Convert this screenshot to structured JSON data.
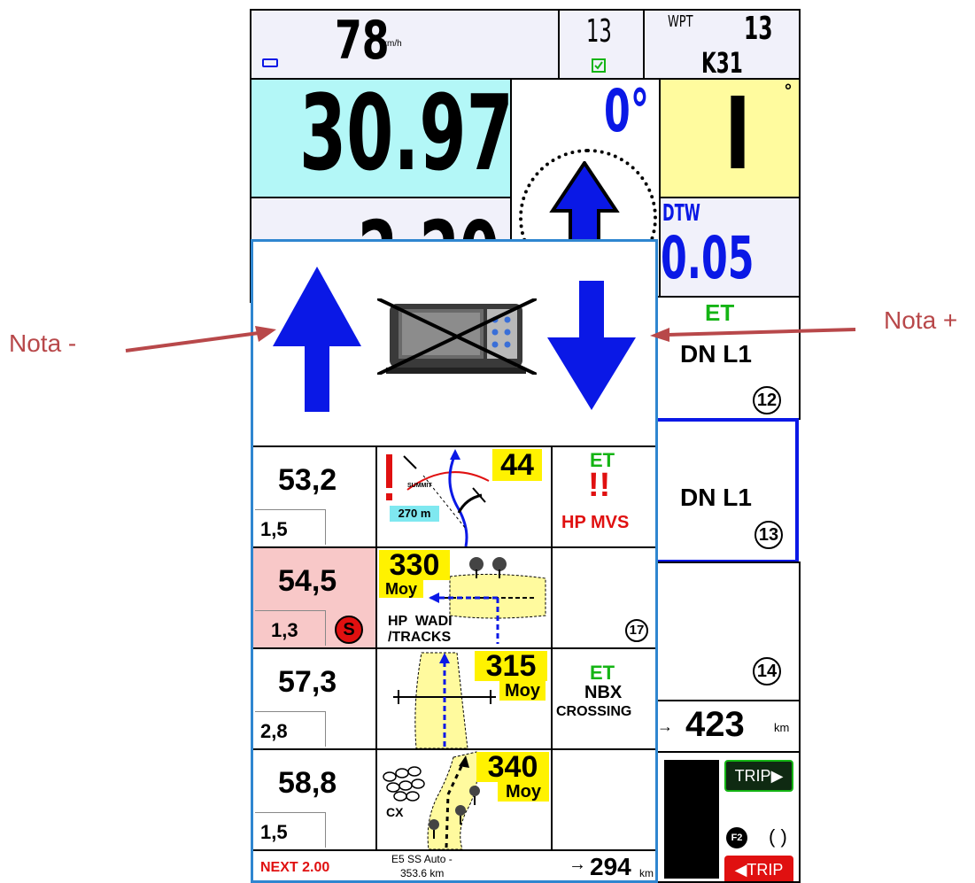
{
  "annotations": {
    "left_label": "Nota -",
    "right_label": "Nota +"
  },
  "colors": {
    "cyan": "#b3f7f7",
    "lightyellow": "#fffb9e",
    "pink": "#f8c8c8",
    "blue": "#0a18e6",
    "green": "#14b414",
    "red": "#e01010",
    "annot": "#b8484a",
    "frame": "#2f86d0"
  },
  "top_bar": {
    "speed": "78",
    "speed_unit": "km/h",
    "wpt_count": "13",
    "wpt_label": "WPT",
    "wpt_number": "13",
    "wpt_name": "K31"
  },
  "nav": {
    "distance_main": "30.97",
    "distance_partial": "2.20",
    "heading": "0°",
    "cap": "I",
    "cap_degree": "°",
    "dtw_label": "DTW",
    "dtw_value": "0.05"
  },
  "right_column": {
    "et1_label": "ET",
    "et1_value": "DN L1",
    "et1_number": "12",
    "et2_value": "DN L1",
    "et2_number": "13",
    "et3_number": "14",
    "total_distance": "423",
    "total_unit": "km",
    "trip_forward": "TRIP",
    "trip_back": "TRIP",
    "f2_label": "F2",
    "paren": "( )"
  },
  "popup": {
    "action_left": "note-minus",
    "action_center": "toggle-device",
    "action_right": "note-plus"
  },
  "roadbook": {
    "rows": [
      {
        "km": "53,2",
        "partial": "1,5",
        "cap": "44",
        "dist_label": "270 m",
        "summit": "SUMMIT",
        "et": "ET",
        "alert": "!!",
        "note": "HP MVS"
      },
      {
        "km": "54,5",
        "partial": "1,3",
        "speed_badge": "S",
        "cap": "330",
        "moy": "Moy",
        "hp": "HP  WADI",
        "tracks": "/TRACKS",
        "number": "17"
      },
      {
        "km": "57,3",
        "partial": "2,8",
        "cap": "315",
        "moy": "Moy",
        "et": "ET",
        "nbx": "NBX",
        "crossing": "CROSSING"
      },
      {
        "km": "58,8",
        "partial": "1,5",
        "cap": "340",
        "moy": "Moy",
        "cx": "CX"
      }
    ]
  },
  "footer": {
    "next": "NEXT 2.00",
    "stage_line1": "E5 SS Auto -",
    "stage_line2": "353.6 km",
    "remaining": "294",
    "remaining_unit": "km"
  }
}
